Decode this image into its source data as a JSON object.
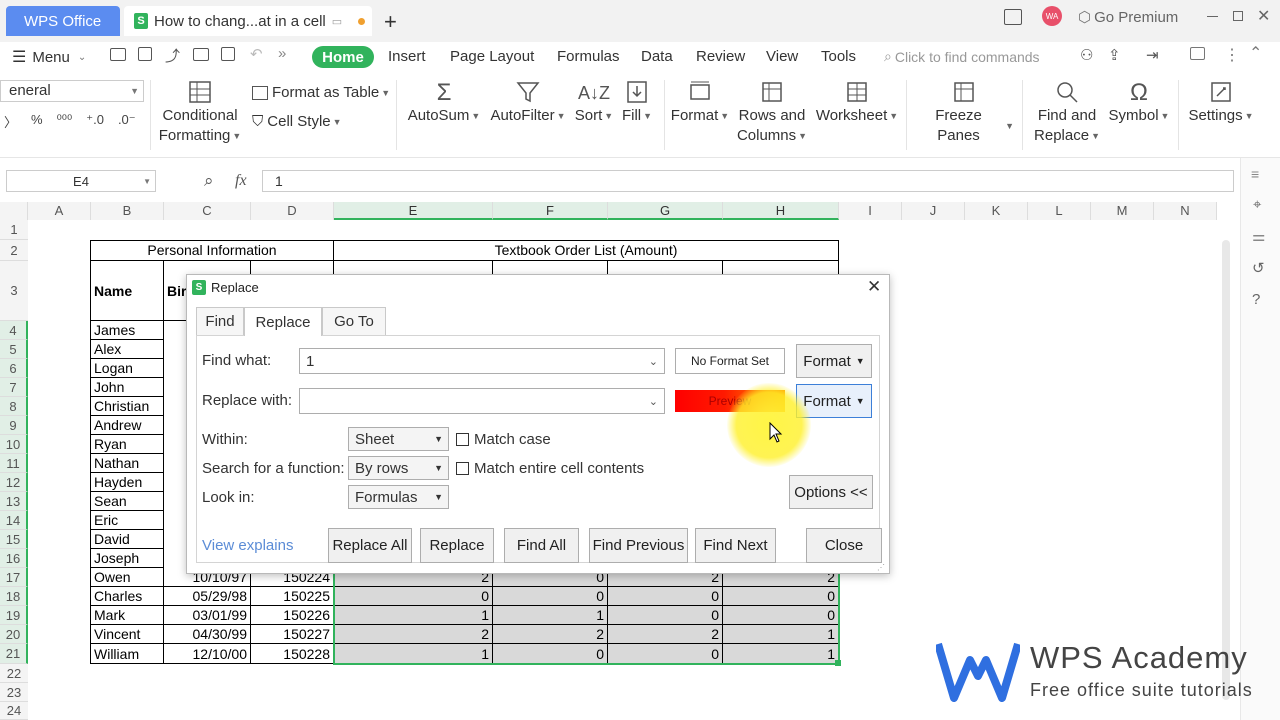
{
  "titlebar": {
    "app_tab": "WPS Office",
    "doc_tab": "How to chang...at in a cell",
    "go_premium": "Go Premium",
    "avatar": "WA"
  },
  "menubar": {
    "menu_label": "Menu",
    "tabs": [
      "Home",
      "Insert",
      "Page Layout",
      "Formulas",
      "Data",
      "Review",
      "View",
      "Tools"
    ],
    "search_placeholder": "Click to find commands"
  },
  "ribbon": {
    "number_format": "eneral",
    "conditional_formatting": [
      "Conditional",
      "Formatting"
    ],
    "format_as_table": "Format as Table",
    "cell_style": "Cell Style",
    "autosum": "AutoSum",
    "autofilter": "AutoFilter",
    "sort": "Sort",
    "fill": "Fill",
    "format": "Format",
    "rows_columns": [
      "Rows and",
      "Columns"
    ],
    "worksheet": "Worksheet",
    "freeze_panes": "Freeze Panes",
    "find_replace": [
      "Find and",
      "Replace"
    ],
    "symbol": "Symbol",
    "settings": "Settings"
  },
  "formulabar": {
    "name_box": "E4",
    "fx": "fx",
    "value": "1"
  },
  "grid": {
    "columns": [
      "A",
      "B",
      "C",
      "D",
      "E",
      "F",
      "G",
      "H",
      "I",
      "J",
      "K",
      "L",
      "M",
      "N"
    ],
    "rows": [
      "1",
      "2",
      "3",
      "4",
      "5",
      "6",
      "7",
      "8",
      "9",
      "10",
      "11",
      "12",
      "13",
      "14",
      "15",
      "16",
      "17",
      "18",
      "19",
      "20",
      "21",
      "22",
      "23",
      "24"
    ],
    "header_personal": "Personal Information",
    "header_textbook": "Textbook Order List (Amount)",
    "name_header": "Name",
    "birth_header_partial": "Bir",
    "names": [
      "James",
      "Alex",
      "Logan",
      "John",
      "Christian",
      "Andrew",
      "Ryan",
      "Nathan",
      "Hayden",
      "Sean",
      "Eric",
      "David",
      "Joseph",
      "Owen",
      "Charles",
      "Mark",
      "Vincent",
      "William"
    ],
    "visible_rows": [
      {
        "birth": "10/10/97",
        "id": "150224",
        "e": "2",
        "f": "0",
        "g": "2",
        "h": "2"
      },
      {
        "birth": "05/29/98",
        "id": "150225",
        "e": "0",
        "f": "0",
        "g": "0",
        "h": "0"
      },
      {
        "birth": "03/01/99",
        "id": "150226",
        "e": "1",
        "f": "1",
        "g": "0",
        "h": "0"
      },
      {
        "birth": "04/30/99",
        "id": "150227",
        "e": "2",
        "f": "2",
        "g": "2",
        "h": "1"
      },
      {
        "birth": "12/10/00",
        "id": "150228",
        "e": "1",
        "f": "0",
        "g": "0",
        "h": "1"
      }
    ]
  },
  "dialog": {
    "title": "Replace",
    "tabs": [
      "Find",
      "Replace",
      "Go To"
    ],
    "find_what_label": "Find what:",
    "find_what_value": "1",
    "no_format_set": "No Format Set",
    "format_button": "Format",
    "replace_with_label": "Replace with:",
    "replace_with_value": "",
    "preview_label": "Preview",
    "within_label": "Within:",
    "within_value": "Sheet",
    "match_case": "Match case",
    "search_label": "Search for a function:",
    "search_value": "By rows",
    "match_entire": "Match entire cell contents",
    "lookin_label": "Look in:",
    "lookin_value": "Formulas",
    "options_button": "Options <<",
    "view_explains": "View explains",
    "buttons": [
      "Replace All",
      "Replace",
      "Find All",
      "Find Previous",
      "Find Next",
      "Close"
    ]
  },
  "watermark": {
    "title": "WPS Academy",
    "subtitle": "Free office suite tutorials"
  },
  "colors": {
    "accent_green": "#31b35c",
    "tab_blue": "#5b8cf0",
    "preview_red": "#ff0000",
    "logo_blue": "#2f6fe0"
  }
}
